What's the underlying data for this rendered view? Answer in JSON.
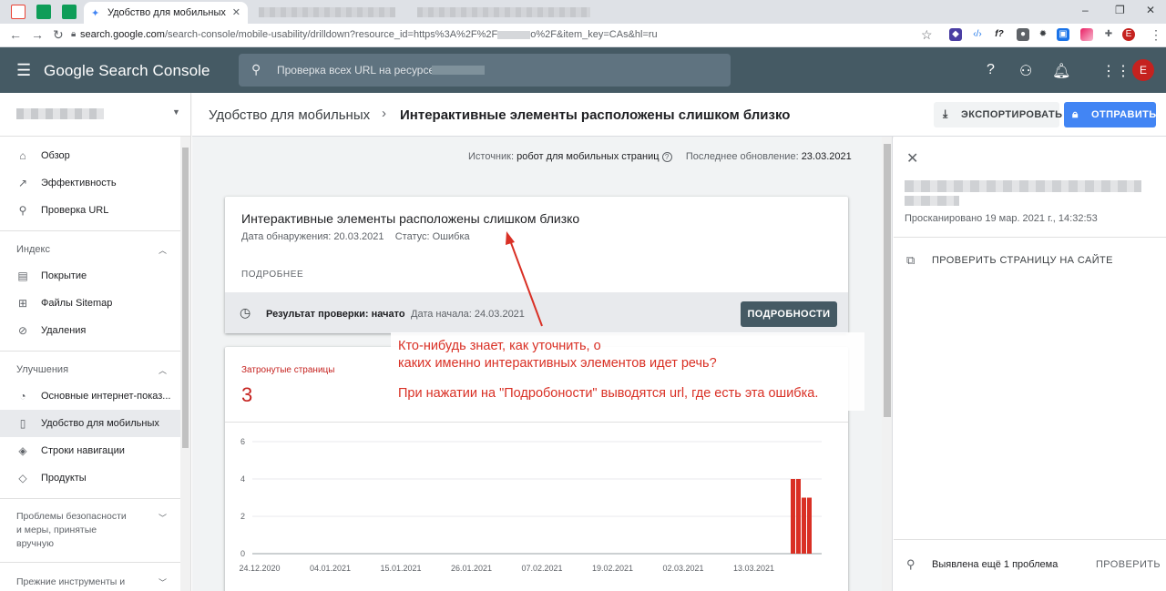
{
  "browser": {
    "active_tab_title": "Удобство для мобильных",
    "url_host": "search.google.com",
    "url_rest": "/search-console/mobile-usability/drilldown?resource_id=https%3A%2F%2F",
    "url_tail": "o%2F&item_key=CAs&hl=ru",
    "profile_initial": "E"
  },
  "header": {
    "logo": "Google Search Console",
    "search_placeholder": "Проверка всех URL на ресурсе",
    "avatar_initial": "E"
  },
  "sidebar": {
    "items_top": [
      {
        "label": "Обзор",
        "icon": "home-icon"
      },
      {
        "label": "Эффективность",
        "icon": "trending-icon"
      },
      {
        "label": "Проверка URL",
        "icon": "search-icon"
      }
    ],
    "section_index": "Индекс",
    "items_index": [
      {
        "label": "Покрытие",
        "icon": "coverage-icon"
      },
      {
        "label": "Файлы Sitemap",
        "icon": "sitemap-icon"
      },
      {
        "label": "Удаления",
        "icon": "removals-icon"
      }
    ],
    "section_improvements": "Улучшения",
    "items_improvements": [
      {
        "label": "Основные интернет-показ...",
        "icon": "gauge-icon"
      },
      {
        "label": "Удобство для мобильных",
        "icon": "phone-icon"
      },
      {
        "label": "Строки навигации",
        "icon": "layers-icon"
      },
      {
        "label": "Продукты",
        "icon": "product-icon"
      }
    ],
    "section_security": "Проблемы безопасности и меры, принятые вручную",
    "section_security_l1": "Проблемы безопасности",
    "section_security_l2": "и меры, принятые",
    "section_security_l3": "вручную",
    "section_legacy": "Прежние инструменты и"
  },
  "titlebar": {
    "crumb1": "Удобство для мобильных",
    "crumb2": "Интерактивные элементы расположены слишком близко",
    "export_label": "ЭКСПОРТИРОВАТЬ",
    "send_label": "ОТПРАВИТЬ"
  },
  "main": {
    "source_label": "Источник:",
    "source_value": "робот для мобильных страниц",
    "updated_label": "Последнее обновление:",
    "updated_value": "23.03.2021",
    "issue_title": "Интерактивные элементы расположены слишком близко",
    "detected_label": "Дата обнаружения:",
    "detected_value": "20.03.2021",
    "status_label": "Статус:",
    "status_value": "Ошибка",
    "more_link": "ПОДРОБНЕЕ",
    "validation_label": "Результат проверки: начато",
    "validation_start": "Дата начала: 24.03.2021",
    "details_button": "ПОДРОБНОСТИ",
    "affected_label": "Затронутые страницы",
    "affected_value": "3"
  },
  "annotation": {
    "line1": "Кто-нибудь знает, как уточнить, о",
    "line2": "каких именно интерактивных элементов идет речь?",
    "line3": "При нажатии на \"Подробоности\" выводятся url, где есть эта ошибка."
  },
  "chart_data": {
    "type": "bar",
    "x_tick_labels": [
      "24.12.2020",
      "04.01.2021",
      "15.01.2021",
      "26.01.2021",
      "07.02.2021",
      "19.02.2021",
      "02.03.2021",
      "13.03.2021"
    ],
    "y_ticks": [
      0,
      2,
      4,
      6
    ],
    "ylim": [
      0,
      6
    ],
    "series": [
      {
        "values_dates": [
          "20.03.2021",
          "21.03.2021",
          "22.03.2021",
          "23.03.2021"
        ],
        "values": [
          4,
          4,
          3,
          3
        ]
      }
    ],
    "color": "#d93025",
    "grid": true
  },
  "rpanel": {
    "scanned": "Просканировано 19 мар. 2021 г., 14:32:53",
    "live_test": "ПРОВЕРИТЬ СТРАНИЦУ НА САЙТЕ",
    "more_issues": "Выявлена ещё 1 проблема",
    "check": "ПРОВЕРИТЬ"
  }
}
